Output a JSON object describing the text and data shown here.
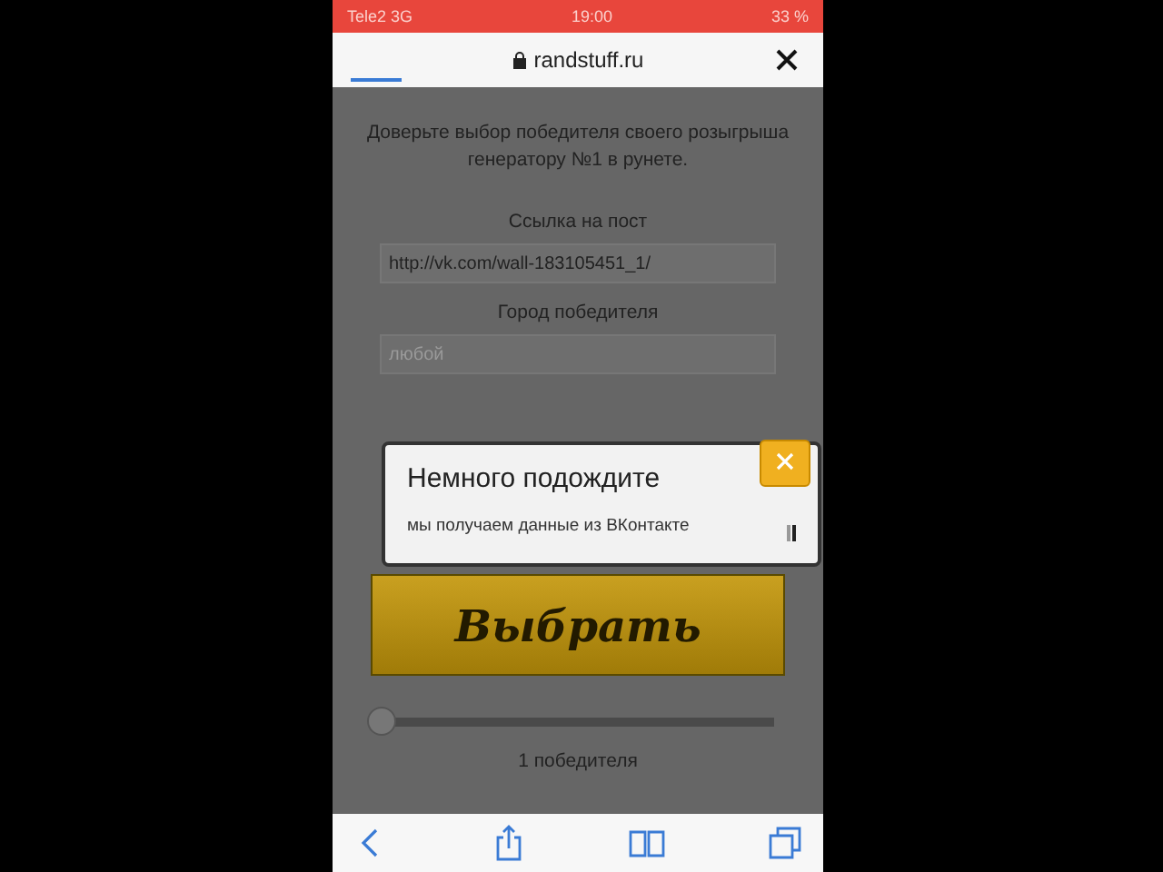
{
  "status_bar": {
    "carrier": "Tele2 3G",
    "time": "19:00",
    "battery": "33 %"
  },
  "address_bar": {
    "domain": "randstuff.ru",
    "loading_bar": {
      "level": 0.12
    }
  },
  "page": {
    "intro": "Доверьте выбор победителя своего розыгрыша генератору №1 в рунете.",
    "post_label": "Ссылка на пост",
    "post_value": "http://vk.com/wall-183105451_1/",
    "city_label": "Город победителя",
    "city_placeholder": "любой",
    "choose_button": "Выбрать",
    "winners_slider": {
      "level": 0
    },
    "winners_count": "1 победителя"
  },
  "dialog": {
    "title": "Немного подождите",
    "message": "мы получаем данные из ВКонтакте"
  }
}
